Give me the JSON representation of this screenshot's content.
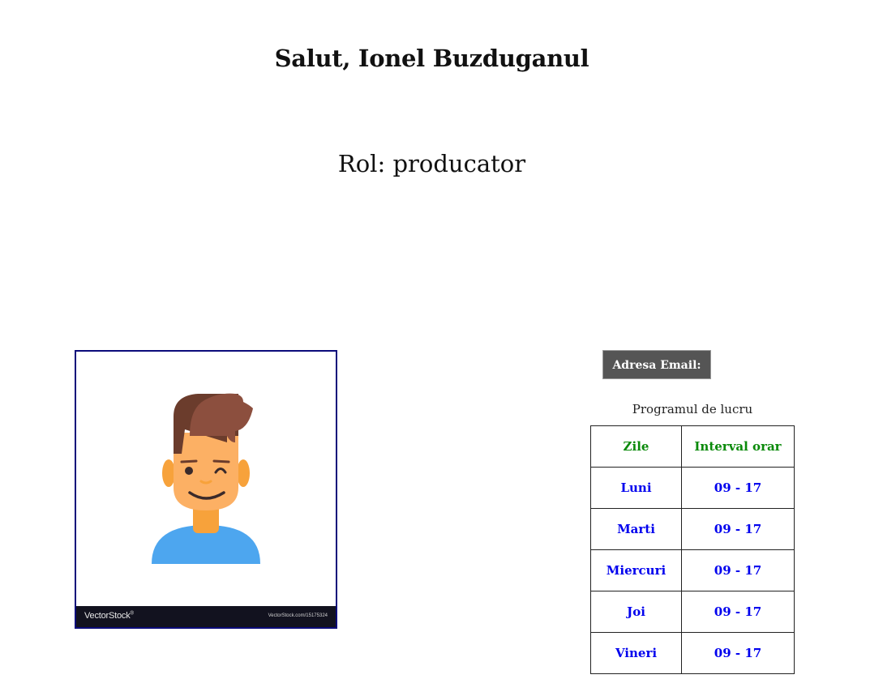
{
  "header": {
    "greeting": "Salut, Ionel Buzduganul",
    "role": "Rol: producator"
  },
  "avatar": {
    "watermark_brand": "VectorStock",
    "watermark_mark": "®",
    "watermark_url": "VectorStock.com/15175324"
  },
  "contact": {
    "email_button_label": "Adresa Email:"
  },
  "schedule": {
    "caption": "Programul de lucru",
    "headers": [
      "Zile",
      "Interval orar"
    ],
    "rows": [
      {
        "day": "Luni",
        "interval": "09 - 17"
      },
      {
        "day": "Marti",
        "interval": "09 - 17"
      },
      {
        "day": "Miercuri",
        "interval": "09 - 17"
      },
      {
        "day": "Joi",
        "interval": "09 - 17"
      },
      {
        "day": "Vineri",
        "interval": "09 - 17"
      }
    ]
  },
  "colors": {
    "header_text": "#0a8a0a",
    "cell_text": "#0000ee",
    "button_bg": "#555555",
    "avatar_border": "#0b0b7a"
  }
}
